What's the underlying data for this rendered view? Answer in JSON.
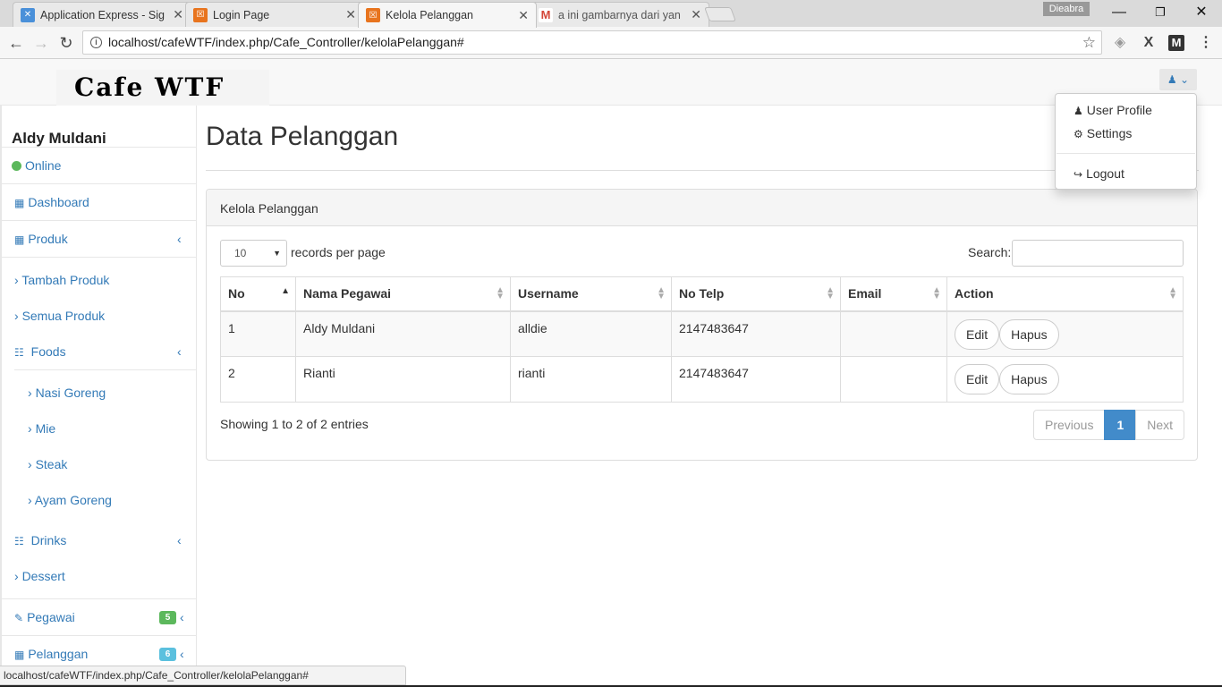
{
  "browser": {
    "tabs": [
      {
        "title": "Application Express - Sig",
        "icon": "apex-icon",
        "color": "#4a90d9"
      },
      {
        "title": "Login Page",
        "icon": "xampp-icon",
        "color": "#e8741e"
      },
      {
        "title": "Kelola Pelanggan",
        "icon": "xampp-icon",
        "color": "#e8741e"
      },
      {
        "title": "a ini gambarnya dari yan",
        "icon": "gmail-icon",
        "color": "#d44638"
      }
    ],
    "profile_name": "Dieabra",
    "url": "localhost/cafeWTF/index.php/Cafe_Controller/kelolaPelanggan#",
    "status_url": "localhost/cafeWTF/index.php/Cafe_Controller/kelolaPelanggan#"
  },
  "app": {
    "logo_text": "Cafe WTF"
  },
  "user_menu": {
    "items": [
      "User Profile",
      "Settings",
      "Logout"
    ]
  },
  "sidebar": {
    "user_name": "Aldy Muldani",
    "status": "Online",
    "items": {
      "dashboard": "Dashboard",
      "produk": "Produk",
      "tambah_produk": "Tambah Produk",
      "semua_produk": "Semua Produk",
      "foods": "Foods",
      "nasi_goreng": "Nasi Goreng",
      "mie": "Mie",
      "steak": "Steak",
      "ayam_goreng": "Ayam Goreng",
      "drinks": "Drinks",
      "dessert": "Dessert",
      "pegawai": "Pegawai",
      "pegawai_badge": "5",
      "pelanggan": "Pelanggan",
      "pelanggan_badge": "6"
    },
    "colors": {
      "badge_green": "#5cb85c",
      "badge_blue": "#5bc0de",
      "link": "#337ab7"
    }
  },
  "main": {
    "page_title": "Data Pelanggan",
    "panel_title": "Kelola Pelanggan",
    "page_length": "10",
    "length_label": "records per page",
    "search_label": "Search:",
    "search_value": "",
    "columns": [
      "No",
      "Nama Pegawai",
      "Username",
      "No Telp",
      "Email",
      "Action"
    ],
    "rows": [
      {
        "no": "1",
        "nama": "Aldy Muldani",
        "username": "alldie",
        "telp": "2147483647",
        "email": "",
        "edit": "Edit",
        "hapus": "Hapus"
      },
      {
        "no": "2",
        "nama": "Rianti",
        "username": "rianti",
        "telp": "2147483647",
        "email": "",
        "edit": "Edit",
        "hapus": "Hapus"
      }
    ],
    "info": "Showing 1 to 2 of 2 entries",
    "pagination": {
      "previous": "Previous",
      "current": "1",
      "next": "Next"
    }
  }
}
